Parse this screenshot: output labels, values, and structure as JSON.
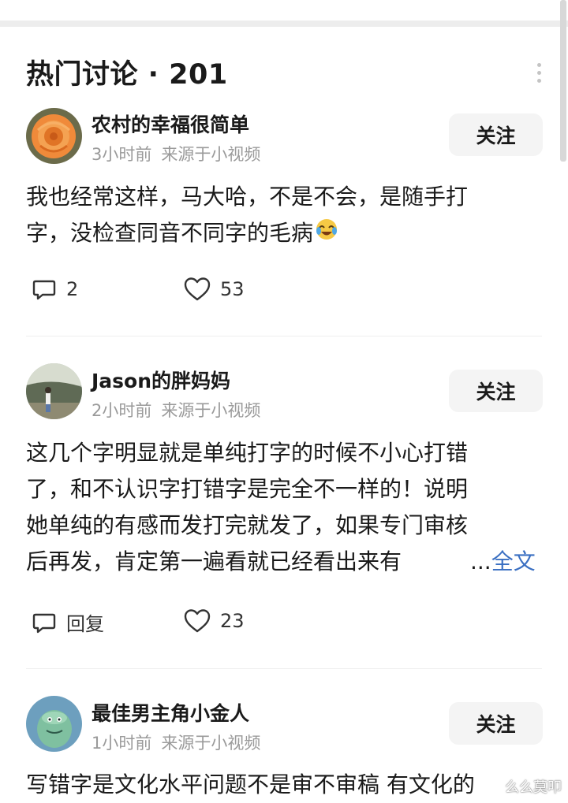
{
  "header": {
    "title": "热门讨论 · 201"
  },
  "comments": [
    {
      "username": "农村的幸福很简单",
      "time": "3小时前",
      "source": "来源于小视频",
      "follow_label": "关注",
      "text_lines": [
        "我也经常这样，马大哈，不是不会，是随手打",
        "字，没检查同音不同字的毛病"
      ],
      "emoji": "crying-laughing-emoji",
      "reply_label": "2",
      "likes": "53"
    },
    {
      "username": "Jason的胖妈妈",
      "time": "2小时前",
      "source": "来源于小视频",
      "follow_label": "关注",
      "text_lines": [
        "这几个字明显就是单纯打字的时候不小心打错",
        "了，和不认识字打错字是完全不一样的！说明",
        "她单纯的有感而发打完就发了，如果专门审核",
        "后再发，肯定第一遍看就已经看出来有"
      ],
      "ellipsis": "...",
      "fulltext_label": "全文",
      "reply_label": "回复",
      "likes": "23"
    },
    {
      "username": "最佳男主角小金人",
      "time": "1小时前",
      "source": "来源于小视频",
      "follow_label": "关注",
      "text_lines": [
        "写错字是文化水平问题不是审不审稿 有文化的"
      ]
    }
  ],
  "watermark": "么么莫叩",
  "colors": {
    "link": "#3a6fc2",
    "meta": "#9a9a9a",
    "button_bg": "#f4f4f4"
  }
}
